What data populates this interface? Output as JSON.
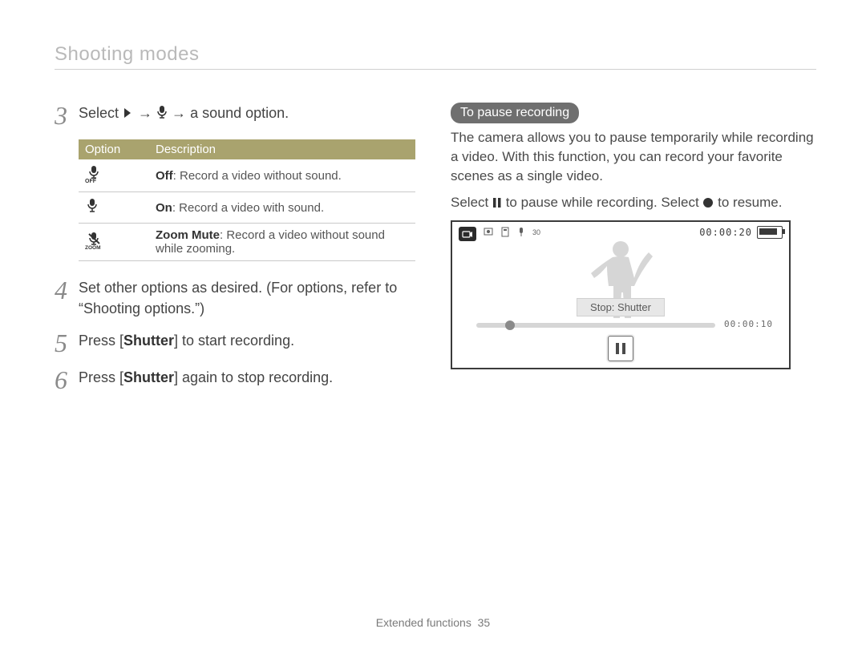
{
  "header": {
    "running_head": "Shooting modes"
  },
  "steps": {
    "s3": {
      "num": "3",
      "prefix": "Select ",
      "mid": " → ",
      "mid2": " → ",
      "suffix": "a sound option."
    },
    "s4": {
      "num": "4",
      "text": "Set other options as desired. (For options, refer to “Shooting options.”)"
    },
    "s5": {
      "num": "5",
      "pre": "Press [",
      "bold": "Shutter",
      "post": "] to start recording."
    },
    "s6": {
      "num": "6",
      "pre": "Press [",
      "bold": "Shutter",
      "post": "] again to stop recording."
    }
  },
  "table": {
    "head": {
      "option": "Option",
      "desc": "Description"
    },
    "rows": [
      {
        "bold": "Off",
        "rest": ": Record a video without sound."
      },
      {
        "bold": "On",
        "rest": ": Record a video with sound."
      },
      {
        "bold": "Zoom Mute",
        "rest": ": Record a video without sound while zooming."
      }
    ]
  },
  "pause": {
    "title": "To pause recording",
    "para": "The camera allows you to pause temporarily while recording a video. With this function, you can record your favorite scenes as a single video.",
    "line2_pre": "Select ",
    "line2_mid": " to pause while recording. Select ",
    "line2_post": " to resume."
  },
  "screen": {
    "timer_top": "00:00:20",
    "stop_label": "Stop: Shutter",
    "timer_bottom": "00:00:10"
  },
  "footer": {
    "section": "Extended functions",
    "page": "35"
  }
}
